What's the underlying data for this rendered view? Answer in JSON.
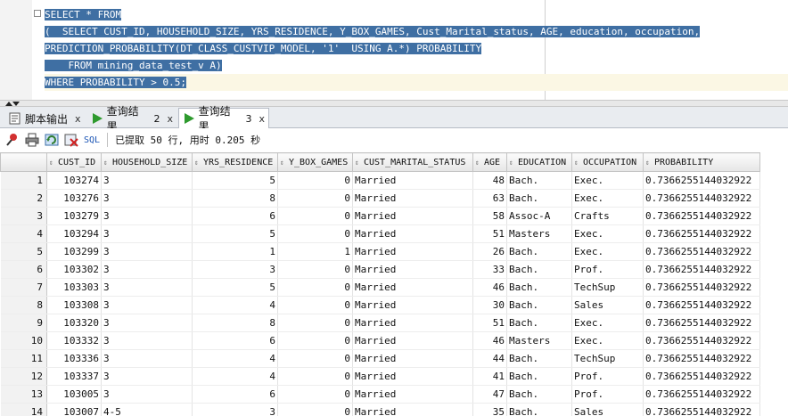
{
  "editor": {
    "lines": [
      "SELECT * FROM",
      "(  SELECT CUST_ID, HOUSEHOLD_SIZE, YRS_RESIDENCE, Y_BOX_GAMES, Cust_Marital_status, AGE, education, occupation,",
      "PREDICTION_PROBABILITY(DT_CLASS_CUSTVIP_MODEL, '1'  USING A.*) PROBABILITY",
      "    FROM mining_data_test_v A)",
      "WHERE PROBABILITY > 0.5;"
    ]
  },
  "tabs": [
    {
      "label": "脚本输出",
      "num": "",
      "close": "x",
      "icon": "script-output-icon"
    },
    {
      "label": "查询结果",
      "num": "2",
      "close": "x",
      "icon": "run-icon"
    },
    {
      "label": "查询结果",
      "num": "3",
      "close": "x",
      "icon": "run-icon"
    }
  ],
  "toolbar": {
    "sql_label": "SQL",
    "status": "已提取 50 行, 用时 0.205 秒"
  },
  "grid": {
    "columns": [
      "CUST_ID",
      "HOUSEHOLD_SIZE",
      "YRS_RESIDENCE",
      "Y_BOX_GAMES",
      "CUST_MARITAL_STATUS",
      "AGE",
      "EDUCATION",
      "OCCUPATION",
      "PROBABILITY"
    ],
    "rows": [
      [
        "1",
        "103274",
        "3",
        "5",
        "0",
        "Married",
        "48",
        "Bach.",
        "Exec.",
        "0.7366255144032922"
      ],
      [
        "2",
        "103276",
        "3",
        "8",
        "0",
        "Married",
        "63",
        "Bach.",
        "Exec.",
        "0.7366255144032922"
      ],
      [
        "3",
        "103279",
        "3",
        "6",
        "0",
        "Married",
        "58",
        "Assoc-A",
        "Crafts",
        "0.7366255144032922"
      ],
      [
        "4",
        "103294",
        "3",
        "5",
        "0",
        "Married",
        "51",
        "Masters",
        "Exec.",
        "0.7366255144032922"
      ],
      [
        "5",
        "103299",
        "3",
        "1",
        "1",
        "Married",
        "26",
        "Bach.",
        "Exec.",
        "0.7366255144032922"
      ],
      [
        "6",
        "103302",
        "3",
        "3",
        "0",
        "Married",
        "33",
        "Bach.",
        "Prof.",
        "0.7366255144032922"
      ],
      [
        "7",
        "103303",
        "3",
        "5",
        "0",
        "Married",
        "46",
        "Bach.",
        "TechSup",
        "0.7366255144032922"
      ],
      [
        "8",
        "103308",
        "3",
        "4",
        "0",
        "Married",
        "30",
        "Bach.",
        "Sales",
        "0.7366255144032922"
      ],
      [
        "9",
        "103320",
        "3",
        "8",
        "0",
        "Married",
        "51",
        "Bach.",
        "Exec.",
        "0.7366255144032922"
      ],
      [
        "10",
        "103332",
        "3",
        "6",
        "0",
        "Married",
        "46",
        "Masters",
        "Exec.",
        "0.7366255144032922"
      ],
      [
        "11",
        "103336",
        "3",
        "4",
        "0",
        "Married",
        "44",
        "Bach.",
        "TechSup",
        "0.7366255144032922"
      ],
      [
        "12",
        "103337",
        "3",
        "4",
        "0",
        "Married",
        "41",
        "Bach.",
        "Prof.",
        "0.7366255144032922"
      ],
      [
        "13",
        "103005",
        "3",
        "6",
        "0",
        "Married",
        "47",
        "Bach.",
        "Prof.",
        "0.7366255144032922"
      ],
      [
        "14",
        "103007",
        "4-5",
        "3",
        "0",
        "Married",
        "35",
        "Bach.",
        "Sales",
        "0.7366255144032922"
      ]
    ]
  }
}
